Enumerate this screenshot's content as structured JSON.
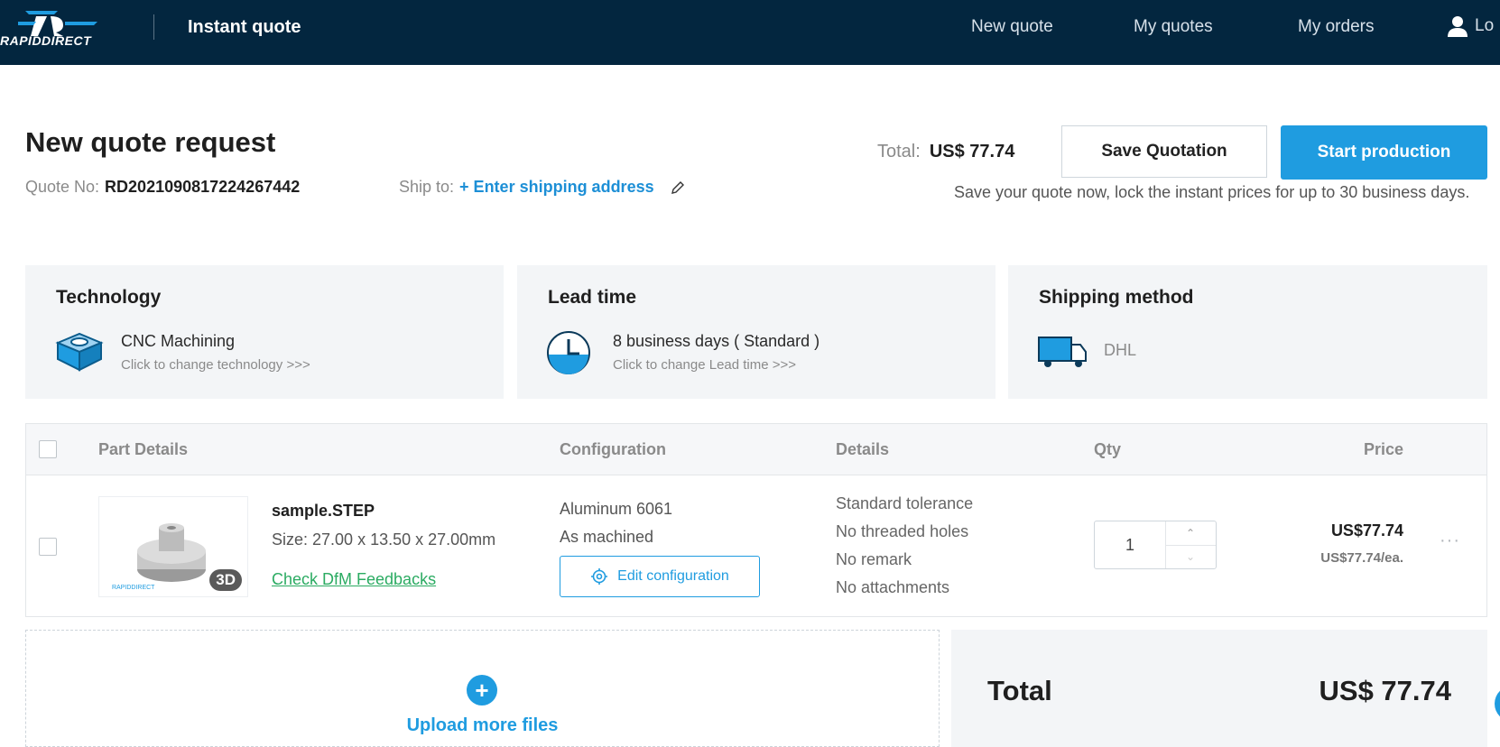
{
  "nav": {
    "logo_text": "RAPIDDIRECT",
    "title": "Instant quote",
    "links": [
      "New quote",
      "My quotes",
      "My orders"
    ],
    "user_label": "Lo"
  },
  "header": {
    "page_title": "New quote request",
    "quote_no_label": "Quote No:",
    "quote_no": "RD2021090817224267442",
    "ship_to_label": "Ship to:",
    "ship_to_link": "+ Enter shipping address",
    "total_label": "Total:",
    "total_amount": "US$ 77.74",
    "save_button": "Save Quotation",
    "start_button": "Start production",
    "save_note": "Save your quote now, lock the instant prices for up to 30 business days."
  },
  "cards": {
    "technology": {
      "title": "Technology",
      "value": "CNC Machining",
      "sub": "Click to change technology >>>"
    },
    "lead_time": {
      "title": "Lead time",
      "value": "8 business days ( Standard )",
      "sub": "Click to change Lead time >>>"
    },
    "shipping": {
      "title": "Shipping method",
      "value": "DHL"
    }
  },
  "table": {
    "headers": {
      "part": "Part Details",
      "config": "Configuration",
      "details": "Details",
      "qty": "Qty",
      "price": "Price"
    },
    "row": {
      "badge": "3D",
      "file_name": "sample.STEP",
      "size": "Size: 27.00 x 13.50 x 27.00mm",
      "dfm_link": "Check DfM Feedbacks",
      "material": "Aluminum 6061",
      "finish": "As machined",
      "edit_button": "Edit configuration",
      "details": [
        "Standard tolerance",
        "No threaded holes",
        "No remark",
        "No attachments"
      ],
      "qty": "1",
      "price": "US$77.74",
      "price_each": "US$77.74/ea."
    }
  },
  "upload": {
    "label": "Upload more files"
  },
  "summary": {
    "label": "Total",
    "amount": "US$ 77.74"
  },
  "colors": {
    "nav_bg": "#03263f",
    "accent": "#1f9ce0",
    "dfm_green": "#2bab62"
  }
}
